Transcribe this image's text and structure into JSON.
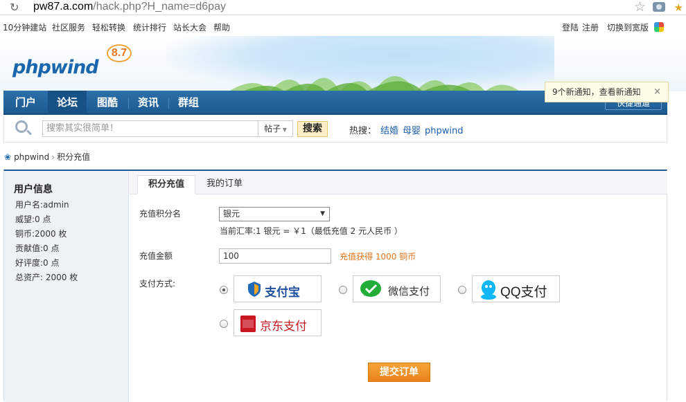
{
  "browser": {
    "url_host": "pw87.a.com",
    "url_path": "/hack.php?H_name=d6pay"
  },
  "toplinks": {
    "left": [
      "10分钟建站",
      "社区服务",
      "轻松转换",
      "统计排行",
      "站长大会",
      "帮助"
    ],
    "login": "登陆",
    "register": "注册",
    "wide": "切换到宽版"
  },
  "logo": {
    "text": "phpwind",
    "version": "8.7"
  },
  "nav": {
    "items": [
      "门户",
      "论坛",
      "图酷",
      "资讯",
      "群组"
    ],
    "active": "论坛",
    "quick": "快捷通道"
  },
  "notice": {
    "prefix": "9个新通知，",
    "link": "查看新通知",
    "close": "×"
  },
  "search": {
    "placeholder": "搜索其实很简单！",
    "scope": "帖子",
    "button": "搜索",
    "hot_label": "热搜：",
    "hot": [
      "结婚",
      "母婴",
      "phpwind"
    ]
  },
  "breadcrumb": {
    "home": "phpwind",
    "current": "积分充值"
  },
  "sidebar": {
    "title": "用户信息",
    "rows": [
      "用户名:admin",
      "威望:0 点",
      "铜币:2000 枚",
      "贡献值:0 点",
      "好评度:0 点",
      "总资产: 2000 枚"
    ]
  },
  "tabs": [
    "积分充值",
    "我的订单"
  ],
  "form": {
    "credit_label": "充值积分名",
    "credit_value": "银元",
    "rate": "当前汇率:1 银元 = ￥1（最低充值 2 元人民币 ）",
    "amount_label": "充值金额",
    "amount_value": "100",
    "gain": "充值获得 1000 铜币",
    "pay_label": "支付方式:",
    "methods": [
      "支付宝",
      "微信支付",
      "QQ支付",
      "京东支付"
    ],
    "selected_method": "支付宝",
    "submit": "提交订单"
  },
  "colors": {
    "nav": "#1c5a91",
    "accent": "#e8741b",
    "submit": "#f39a2e"
  }
}
